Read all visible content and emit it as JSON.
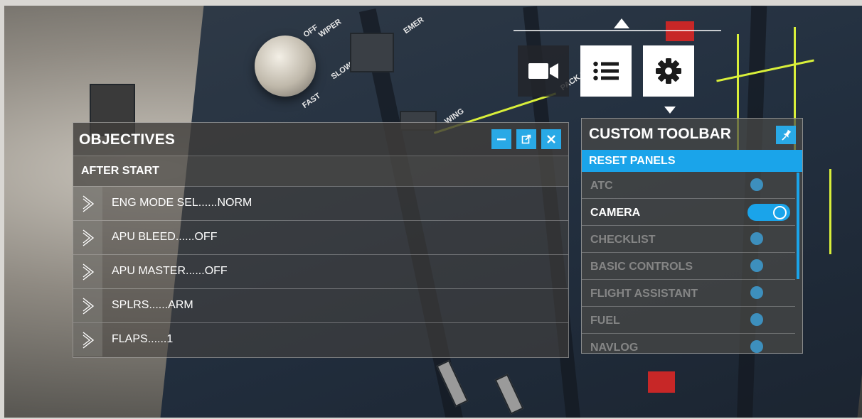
{
  "cockpit_labels": {
    "wiper": "WIPER",
    "off": "OFF",
    "slow": "SLOW",
    "fast": "FAST",
    "emer": "EMER",
    "wing": "WING",
    "pack": "PACK 1"
  },
  "top_toolbar": {
    "buttons": [
      {
        "icon": "video-camera-icon"
      },
      {
        "icon": "list-menu-icon"
      },
      {
        "icon": "gear-icon"
      }
    ]
  },
  "objectives": {
    "title": "OBJECTIVES",
    "section": "AFTER START",
    "items": [
      {
        "text": "ENG MODE SEL......NORM"
      },
      {
        "text": "APU BLEED......OFF"
      },
      {
        "text": "APU MASTER......OFF"
      },
      {
        "text": "SPLRS......ARM"
      },
      {
        "text": "FLAPS......1"
      }
    ]
  },
  "custom_toolbar": {
    "title": "CUSTOM TOOLBAR",
    "reset_label": "RESET PANELS",
    "items": [
      {
        "label": "ATC",
        "enabled": false
      },
      {
        "label": "CAMERA",
        "enabled": true
      },
      {
        "label": "CHECKLIST",
        "enabled": false
      },
      {
        "label": "BASIC CONTROLS",
        "enabled": false
      },
      {
        "label": "FLIGHT ASSISTANT",
        "enabled": false
      },
      {
        "label": "FUEL",
        "enabled": false
      },
      {
        "label": "NAVLOG",
        "enabled": false
      }
    ]
  },
  "colors": {
    "accent": "#1aa4ea",
    "panel_line": "#d9ef3a"
  }
}
